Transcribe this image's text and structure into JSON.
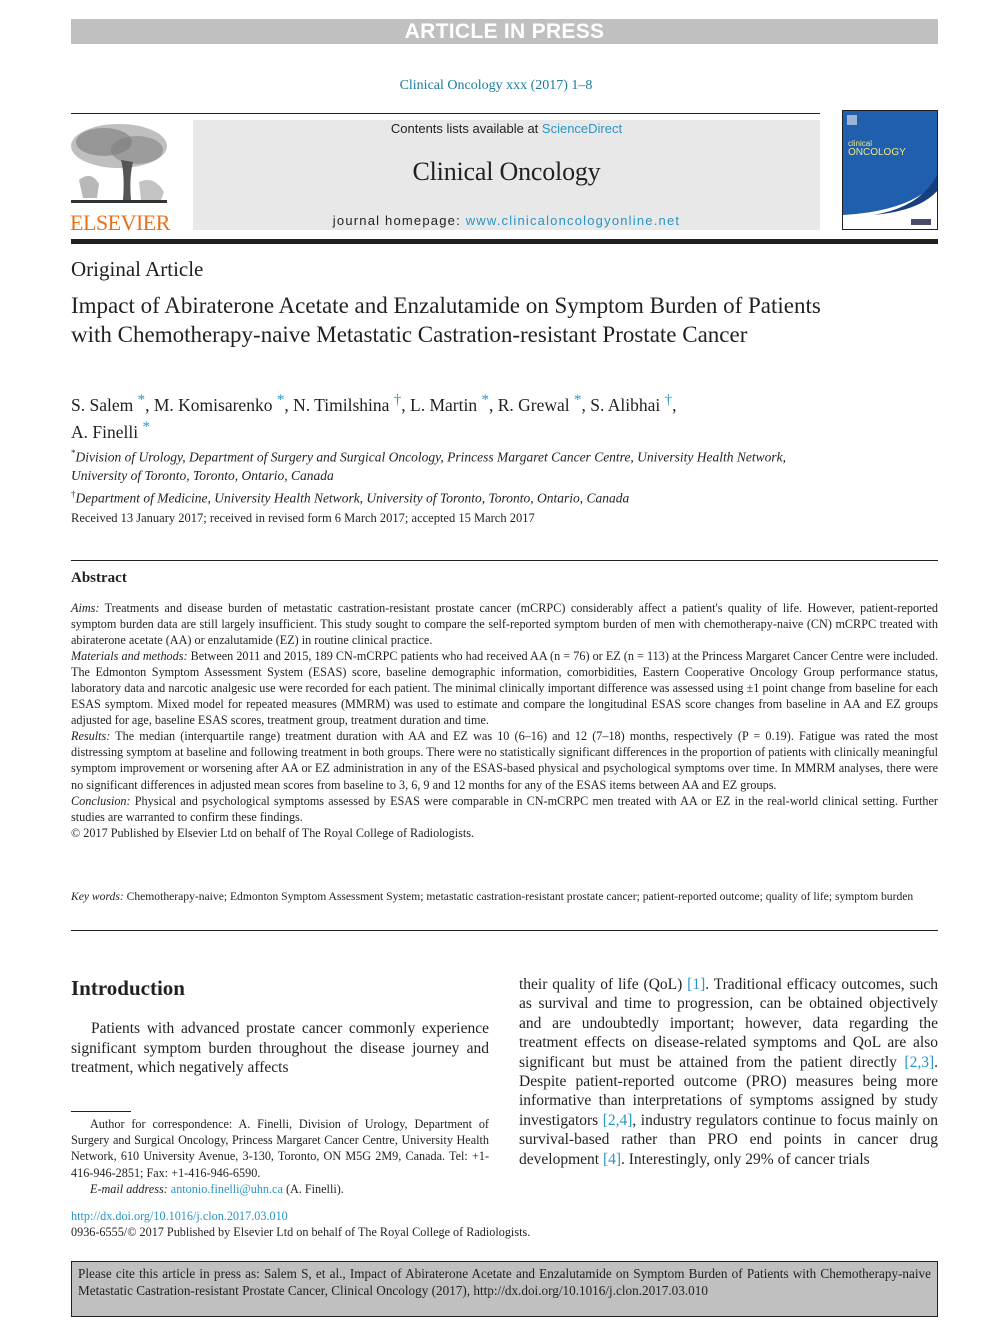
{
  "banner": "ARTICLE IN PRESS",
  "journal_ref": "Clinical Oncology xxx (2017) 1–8",
  "masthead": {
    "contents_prefix": "Contents lists available at ",
    "contents_link": "ScienceDirect",
    "journal_title": "Clinical Oncology",
    "homepage_prefix": "journal homepage: ",
    "homepage_link": "www.clinicaloncologyonline.net"
  },
  "publisher_logo": "ELSEVIER",
  "cover": {
    "title_line1": "clinical",
    "title_line2": "ONCOLOGY"
  },
  "article_type": "Original Article",
  "title": "Impact of Abiraterone Acetate and Enzalutamide on Symptom Burden of Patients with Chemotherapy-naive Metastatic Castration-resistant Prostate Cancer",
  "authors": [
    {
      "name": "S. Salem",
      "mark": "*",
      "sep": ", "
    },
    {
      "name": "M. Komisarenko",
      "mark": "*",
      "sep": ", "
    },
    {
      "name": "N. Timilshina",
      "mark": "†",
      "sep": ", "
    },
    {
      "name": "L. Martin",
      "mark": "*",
      "sep": ", "
    },
    {
      "name": "R. Grewal",
      "mark": "*",
      "sep": ", "
    },
    {
      "name": "S. Alibhai",
      "mark": "†",
      "sep": ", "
    },
    {
      "name": "A. Finelli",
      "mark": "*",
      "sep": ""
    }
  ],
  "affiliations": [
    {
      "mark": "*",
      "text": "Division of Urology, Department of Surgery and Surgical Oncology, Princess Margaret Cancer Centre, University Health Network, University of Toronto, Toronto, Ontario, Canada"
    },
    {
      "mark": "†",
      "text": "Department of Medicine, University Health Network, University of Toronto, Toronto, Ontario, Canada"
    }
  ],
  "received": "Received 13 January 2017; received in revised form 6 March 2017; accepted 15 March 2017",
  "abstract": {
    "heading": "Abstract",
    "sections": [
      {
        "label": "Aims:",
        "text": " Treatments and disease burden of metastatic castration-resistant prostate cancer (mCRPC) considerably affect a patient's quality of life. However, patient-reported symptom burden data are still largely insufficient. This study sought to compare the self-reported symptom burden of men with chemotherapy-naive (CN) mCRPC treated with abiraterone acetate (AA) or enzalutamide (EZ) in routine clinical practice."
      },
      {
        "label": "Materials and methods:",
        "text": " Between 2011 and 2015, 189 CN-mCRPC patients who had received AA (n = 76) or EZ (n = 113) at the Princess Margaret Cancer Centre were included. The Edmonton Symptom Assessment System (ESAS) score, baseline demographic information, comorbidities, Eastern Cooperative Oncology Group performance status, laboratory data and narcotic analgesic use were recorded for each patient. The minimal clinically important difference was assessed using ±1 point change from baseline for each ESAS symptom. Mixed model for repeated measures (MMRM) was used to estimate and compare the longitudinal ESAS score changes from baseline in AA and EZ groups adjusted for age, baseline ESAS scores, treatment group, treatment duration and time."
      },
      {
        "label": "Results:",
        "text": " The median (interquartile range) treatment duration with AA and EZ was 10 (6–16) and 12 (7–18) months, respectively (P = 0.19). Fatigue was rated the most distressing symptom at baseline and following treatment in both groups. There were no statistically significant differences in the proportion of patients with clinically meaningful symptom improvement or worsening after AA or EZ administration in any of the ESAS-based physical and psychological symptoms over time. In MMRM analyses, there were no significant differences in adjusted mean scores from baseline to 3, 6, 9 and 12 months for any of the ESAS items between AA and EZ groups."
      },
      {
        "label": "Conclusion:",
        "text": " Physical and psychological symptoms assessed by ESAS were comparable in CN-mCRPC men treated with AA or EZ in the real-world clinical setting. Further studies are warranted to confirm these findings."
      }
    ],
    "copyright": "© 2017 Published by Elsevier Ltd on behalf of The Royal College of Radiologists."
  },
  "key_words": {
    "label": "Key words:",
    "text": " Chemotherapy-naive; Edmonton Symptom Assessment System; metastatic castration-resistant prostate cancer; patient-reported outcome; quality of life; symptom burden"
  },
  "introduction": {
    "heading": "Introduction",
    "left_text": "Patients with advanced prostate cancer commonly experience significant symptom burden throughout the disease journey and treatment, which negatively affects",
    "right_parts": [
      {
        "t": "text",
        "v": "their quality of life (QoL) "
      },
      {
        "t": "ref",
        "v": "[1]"
      },
      {
        "t": "text",
        "v": ". Traditional efficacy outcomes, such as survival and time to progression, can be obtained objectively and are undoubtedly important; however, data regarding the treatment effects on disease-related symp­toms and QoL are also significant but must be attained from the patient directly "
      },
      {
        "t": "ref",
        "v": "[2,3]"
      },
      {
        "t": "text",
        "v": ". Despite patient-reported outcome (PRO) measures being more informative than in­terpretations of symptoms assigned by study investigators "
      },
      {
        "t": "ref",
        "v": "[2,4]"
      },
      {
        "t": "text",
        "v": ", industry regulators continue to focus mainly on survival-based rather than PRO end points in cancer drug development "
      },
      {
        "t": "ref",
        "v": "[4]"
      },
      {
        "t": "text",
        "v": ". Interestingly, only 29% of cancer trials"
      }
    ]
  },
  "footnote": {
    "correspondence": "Author for correspondence: A. Finelli, Division of Urology, Department of Surgery and Surgical Oncology, Princess Margaret Cancer Centre, University Health Network, 610 University Avenue, 3-130, Toronto, ON M5G 2M9, Canada. Tel: +1-416-946-2851; Fax: +1-416-946-6590.",
    "email_label": "E-mail address:",
    "email": "antonio.finelli@uhn.ca",
    "email_suffix": " (A. Finelli)."
  },
  "doi": "http://dx.doi.org/10.1016/j.clon.2017.03.010",
  "issn_line": "0936-6555/© 2017 Published by Elsevier Ltd on behalf of The Royal College of Radiologists.",
  "cite_box": "Please cite this article in press as: Salem S, et al., Impact of Abiraterone Acetate and Enzalutamide on Symptom Burden of Patients with Chemotherapy-naive Metastatic Castration-resistant Prostate Cancer, Clinical Oncology (2017), http://dx.doi.org/10.1016/j.clon.2017.03.010",
  "colors": {
    "link": "#2a94c7",
    "elsevier_orange": "#e9711c",
    "banner_gray": "#c0c0c0",
    "masthead_gray": "#e8e8e8",
    "cover_blue": "#1f5fae"
  }
}
